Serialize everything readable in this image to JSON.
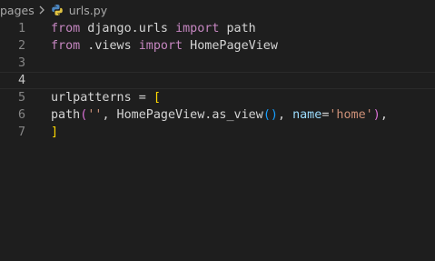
{
  "breadcrumb": {
    "folder": "pages",
    "separator_icon": "chevron-right-icon",
    "file_icon": "python-icon",
    "file": "urls.py"
  },
  "editor": {
    "active_line": 4,
    "lines": [
      {
        "number": "1",
        "tokens": [
          {
            "type": "kw",
            "text": "from"
          },
          {
            "type": "plain",
            "text": " django.urls "
          },
          {
            "type": "kw",
            "text": "import"
          },
          {
            "type": "plain",
            "text": " path"
          }
        ]
      },
      {
        "number": "2",
        "tokens": [
          {
            "type": "kw",
            "text": "from"
          },
          {
            "type": "plain",
            "text": " .views "
          },
          {
            "type": "kw",
            "text": "import"
          },
          {
            "type": "plain",
            "text": " HomePageView"
          }
        ]
      },
      {
        "number": "3",
        "tokens": []
      },
      {
        "number": "4",
        "tokens": []
      },
      {
        "number": "5",
        "tokens": [
          {
            "type": "plain",
            "text": "urlpatterns = "
          },
          {
            "type": "b1",
            "text": "["
          }
        ]
      },
      {
        "number": "6",
        "tokens": [
          {
            "type": "plain",
            "text": "path"
          },
          {
            "type": "b2",
            "text": "("
          },
          {
            "type": "str",
            "text": "''"
          },
          {
            "type": "plain",
            "text": ", HomePageView.as_view"
          },
          {
            "type": "b3",
            "text": "()"
          },
          {
            "type": "plain",
            "text": ", "
          },
          {
            "type": "param",
            "text": "name"
          },
          {
            "type": "plain",
            "text": "="
          },
          {
            "type": "str",
            "text": "'home'"
          },
          {
            "type": "b2",
            "text": ")"
          },
          {
            "type": "plain",
            "text": ","
          }
        ]
      },
      {
        "number": "7",
        "tokens": [
          {
            "type": "b1",
            "text": "]"
          }
        ]
      }
    ]
  },
  "colors": {
    "background": "#1e1e1e",
    "keyword": "#c586c0",
    "string": "#ce9178",
    "parameter": "#9cdcfe",
    "bracket_level1": "#ffd700",
    "bracket_level2": "#da70d6",
    "bracket_level3": "#179fff",
    "line_number": "#858585"
  }
}
